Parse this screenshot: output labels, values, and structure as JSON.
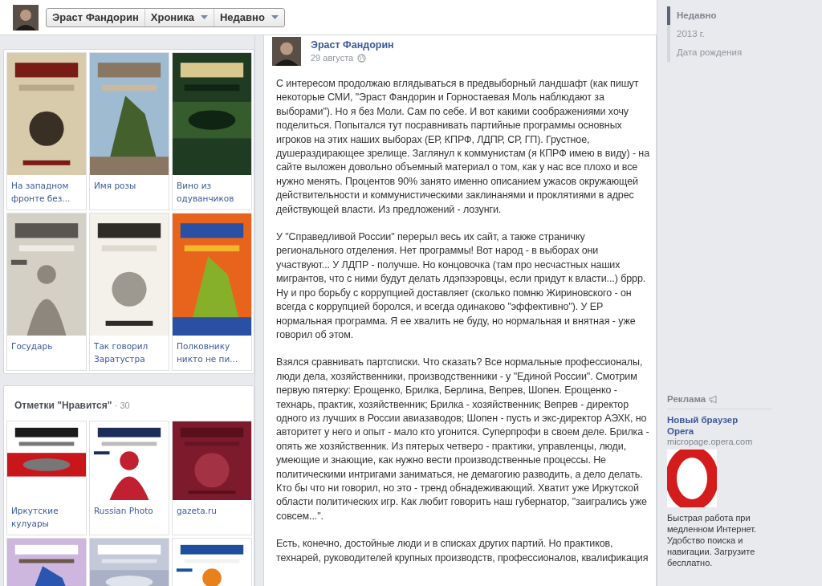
{
  "header": {
    "breadcrumbs": [
      {
        "label": "Эраст Фандорин",
        "dropdown": false
      },
      {
        "label": "Хроника",
        "dropdown": true
      },
      {
        "label": "Недавно",
        "dropdown": true
      }
    ]
  },
  "books": {
    "items": [
      {
        "title": "На западном фронте без..."
      },
      {
        "title": "Имя розы"
      },
      {
        "title": "Вино из одуванчиков"
      },
      {
        "title": "Государь"
      },
      {
        "title": "Так говорил Заратустра"
      },
      {
        "title": "Полковнику никто не пи..."
      }
    ]
  },
  "likes": {
    "title": "Отметки \"Нравится\"",
    "count": "· 30",
    "items": [
      {
        "title": "Иркутские кулуары"
      },
      {
        "title": "Russian Photo"
      },
      {
        "title": "gazeta.ru"
      },
      {
        "kind": "picture"
      },
      {
        "kind": "picture"
      },
      {
        "kind": "picture"
      }
    ]
  },
  "post": {
    "author": "Эраст Фандорин",
    "date": "29 августа",
    "paragraphs": [
      "С интересом продолжаю вглядываться в предвыборный ландшафт (как пишут некоторые СМИ, \"Эраст Фандорин и Горностаевая Моль наблюдают за выборами\"). Но я без Моли. Сам по себе. И вот какими соображениями хочу поделиться. Попытался тут посравнивать партийные программы основных игроков на этих наших выборах (ЕР, КПРФ, ЛДПР, СР, ГП). Грустное, душераздирающее зрелище. Заглянул к коммунистам (я КПРФ имею в виду) - на сайте выложен довольно объемный материал о том, как у нас все плохо и все нужно менять. Процентов 90% занято именно описанием ужасов окружающей действительности и коммунистическими заклинанями и проклятиями в адрес действующей власти. Из предложений - лозунги.",
      "У \"Справедливой России\" перерыл весь их сайт, а также страничку регионального отделения. Нет программы! Вот народ - в выборах они участвуют... У ЛДПР - получше. Но концовочка (там про несчастных наших мигрантов, что с ними будут делать лдэпээровцы, если придут к власти...) бррр. Ну и про борьбу с коррупцией доставляет (сколько помню Жириновского - он всегда с коррупцией боролся, и всегда одинаково \"эффективно\"). У ЕР нормальная программа. Я ее хвалить не буду, но нормальная и внятная - уже говорил об этом.",
      "Взялся сравнивать партсписки. Что сказать? Все нормальные профессионалы, люди дела, хозяйственники, производственники - у \"Единой России\". Смотрим первую пятерку: Ерощенко, Брилка, Берлина, Вепрев, Шопен. Ерощенко - технарь, практик, хозяйственник; Брилка - хозяйственник; Вепрев - директор одного из лучших в России авиазаводов; Шопен - пусть и экс-директор АЭХК, но авторитет у него и опыт - мало кто угонится. Суперпрофи в своем деле. Брилка - опять же хозяйственник. Из пятерых четверо - практики, управленцы, люди, умеющие и знающие, как нужно вести производственные процессы. Не политическими интригами заниматься, не демагогию разводить, а дело делать. Кто бы что ни говорил, но это - тренд обнадеживающий. Хватит уже Иркутской области политических игр. Как любит говорить наш губернатор, \"заигрались уже совсем...\".",
      "Есть, конечно, достойные люди и в списках других партий. Но практиков, технарей, руководителей крупных производств, профессионалов, квалификация"
    ]
  },
  "timeline_nav": {
    "items": [
      {
        "label": "Недавно",
        "selected": true
      },
      {
        "label": "2013 г.",
        "selected": false
      },
      {
        "label": "Дата рождения",
        "selected": false
      }
    ]
  },
  "ad": {
    "heading": "Реклама",
    "title": "Новый браузер Opera",
    "url": "micropage.opera.com",
    "text": "Быстрая работа при медленном Интернет. Удобство поиска и навигации. Загрузите бесплатно."
  }
}
